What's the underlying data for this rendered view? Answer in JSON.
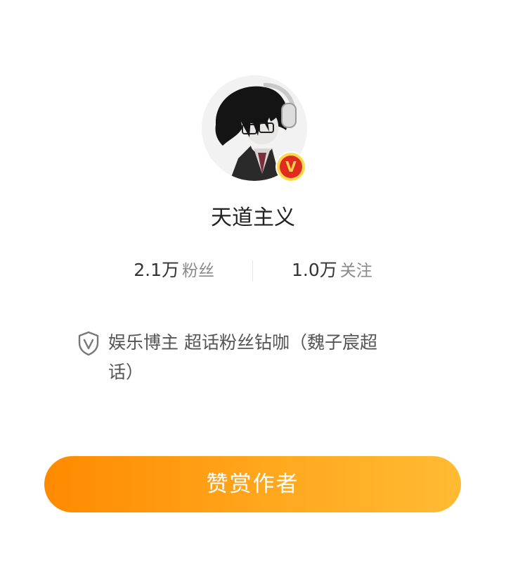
{
  "profile": {
    "username": "天道主义",
    "verified_badge": "V",
    "avatar_icon": "avatar-anime-boy-headphones"
  },
  "stats": {
    "fans_count": "2.1万",
    "fans_label": "粉丝",
    "following_count": "1.0万",
    "following_label": "关注"
  },
  "verification": {
    "icon": "shield-v-icon",
    "text": "娱乐博主 超话粉丝钻咖（魏子宸超话）"
  },
  "actions": {
    "reward_label": "赞赏作者"
  },
  "colors": {
    "button_gradient_start": "#ff8a00",
    "button_gradient_end": "#ffbb33",
    "badge_red": "#e02b1f",
    "badge_gold": "#ffd84d"
  }
}
